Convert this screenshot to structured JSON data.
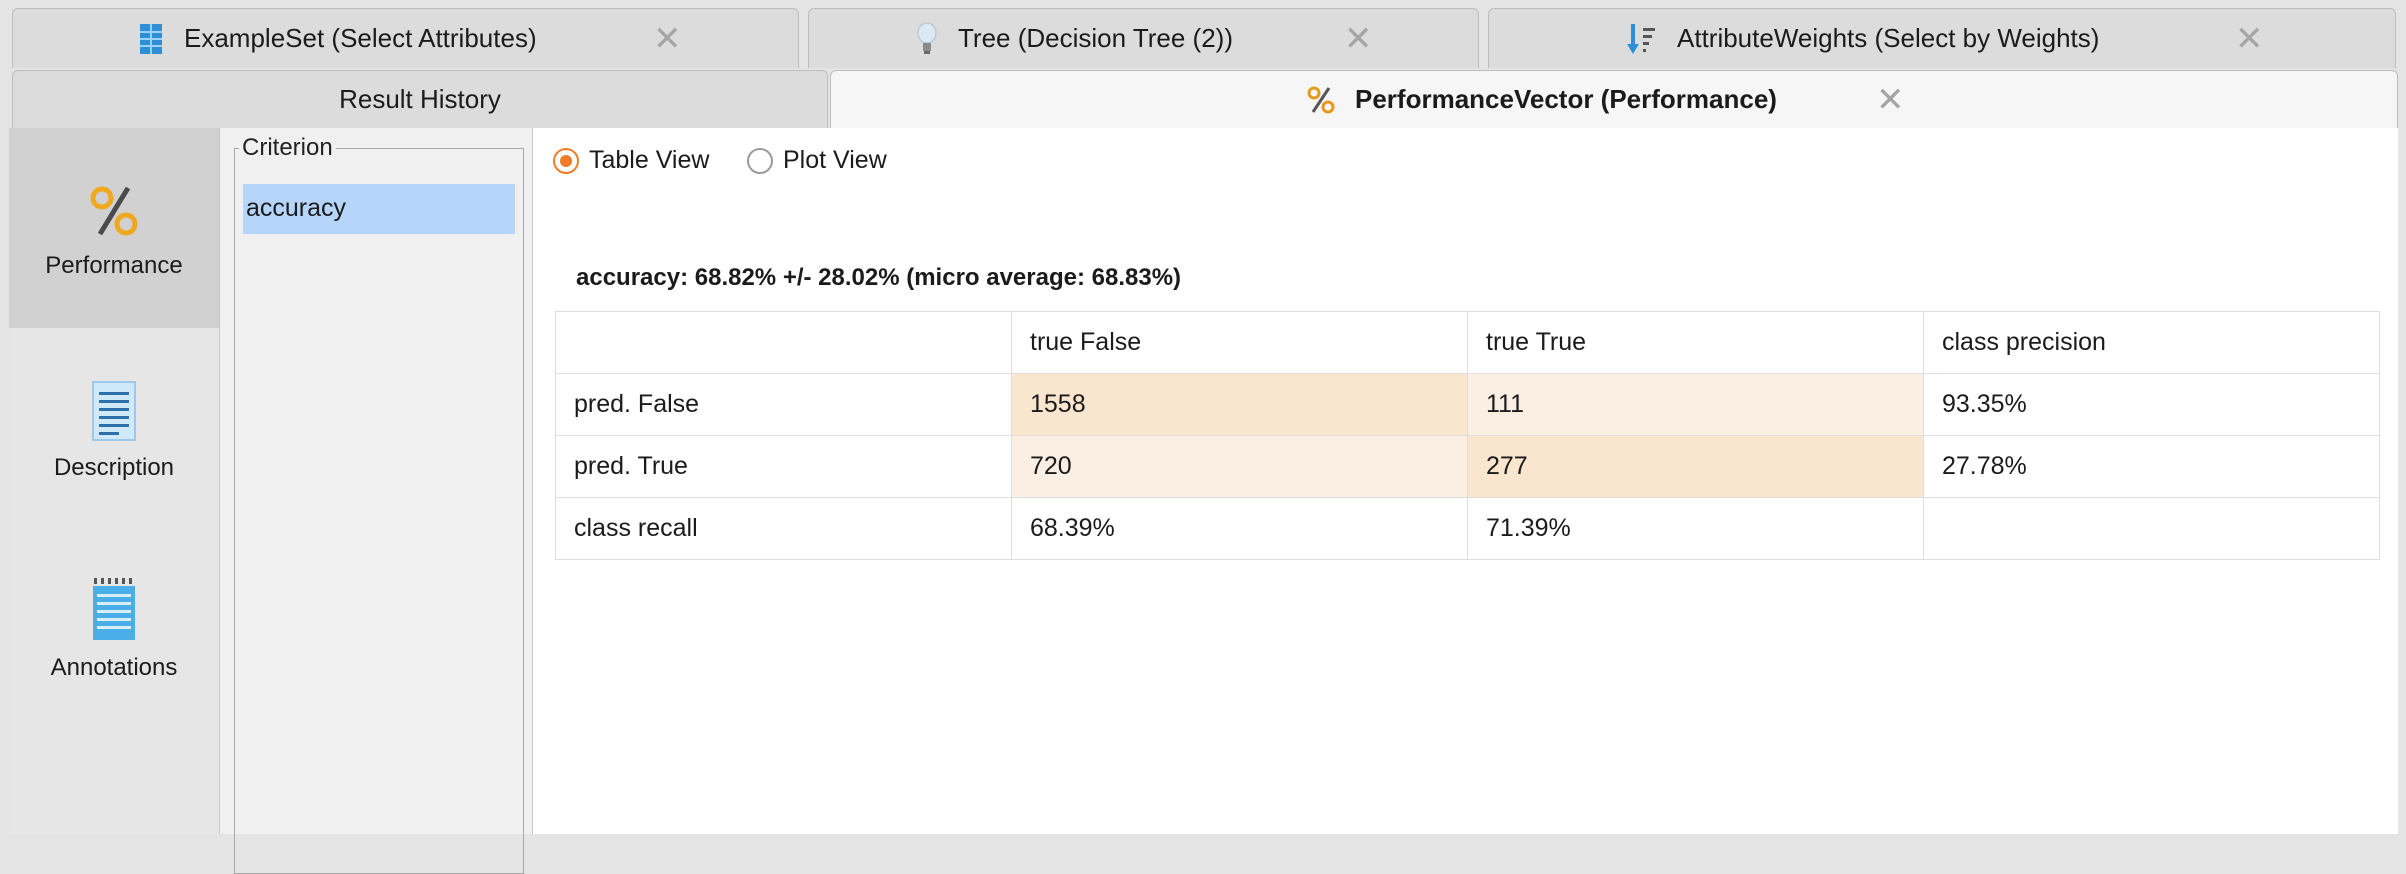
{
  "tabs_row1": [
    {
      "label": "ExampleSet (Select Attributes)",
      "icon": "table-icon"
    },
    {
      "label": "Tree (Decision Tree (2))",
      "icon": "lightbulb-icon"
    },
    {
      "label": "AttributeWeights (Select by Weights)",
      "icon": "sort-weights-icon"
    }
  ],
  "tabs_row2": [
    {
      "label": "Result History"
    },
    {
      "label": "PerformanceVector (Performance)",
      "icon": "percent-icon"
    }
  ],
  "close_symbol": "✕",
  "sidebar": {
    "items": [
      {
        "label": "Performance",
        "icon": "percent-icon"
      },
      {
        "label": "Description",
        "icon": "document-icon"
      },
      {
        "label": "Annotations",
        "icon": "notepad-icon"
      }
    ]
  },
  "criterion": {
    "legend": "Criterion",
    "items": [
      "accuracy"
    ]
  },
  "view_toggle": {
    "table_view": "Table View",
    "plot_view": "Plot View",
    "selected": "Table View"
  },
  "summary": "accuracy: 68.82% +/- 28.02% (micro average: 68.83%)",
  "matrix": {
    "headers": [
      "",
      "true False",
      "true True",
      "class precision"
    ],
    "rows": [
      [
        "pred. False",
        "1558",
        "111",
        "93.35%"
      ],
      [
        "pred. True",
        "720",
        "277",
        "27.78%"
      ],
      [
        "class recall",
        "68.39%",
        "71.39%",
        ""
      ]
    ]
  },
  "colors": {
    "accent": "#f07d26",
    "selection": "#b5d5fa",
    "cell_dark": "#fae6cf",
    "cell_light": "#faefe2"
  }
}
